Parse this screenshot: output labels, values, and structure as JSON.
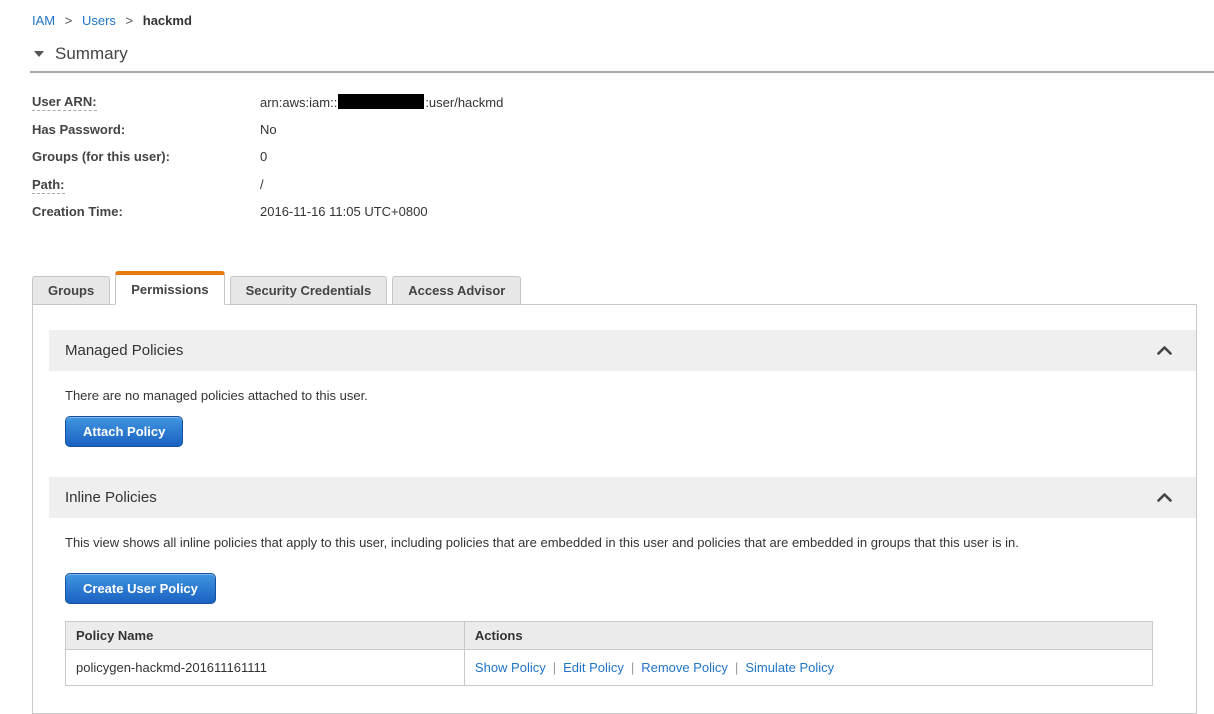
{
  "breadcrumb": {
    "separator": ">",
    "items": [
      {
        "label": "IAM"
      },
      {
        "label": "Users"
      },
      {
        "label": "hackmd"
      }
    ]
  },
  "summary": {
    "title": "Summary",
    "fields": [
      {
        "label": "User ARN:",
        "value_prefix": "arn:aws:iam::",
        "value_redacted": "account-id-redacted",
        "value_suffix": ":user/hackmd"
      },
      {
        "label": "Has Password:",
        "value": "No"
      },
      {
        "label": "Groups (for this user):",
        "value": "0"
      },
      {
        "label": "Path:",
        "value": "/"
      },
      {
        "label": "Creation Time:",
        "value": "2016-11-16 11:05 UTC+0800"
      }
    ]
  },
  "tabs": {
    "items": [
      "Groups",
      "Permissions",
      "Security Credentials",
      "Access Advisor"
    ],
    "active": "Permissions"
  },
  "managed_policies": {
    "title": "Managed Policies",
    "empty_text": "There are no managed policies attached to this user.",
    "attach_button_label": "Attach Policy"
  },
  "inline_policies": {
    "title": "Inline Policies",
    "description": "This view shows all inline policies that apply to this user, including policies that are embedded in this user and policies that are embedded in groups that this user is in.",
    "create_button_label": "Create User Policy",
    "table": {
      "headers": [
        "Policy Name",
        "Actions"
      ],
      "actions_separator": "|",
      "rows": [
        {
          "policy_name": "policygen-hackmd-201611161111",
          "actions": [
            "Show Policy",
            "Edit Policy",
            "Remove Policy",
            "Simulate Policy"
          ]
        }
      ]
    }
  },
  "colors": {
    "link_blue": "#2075c7",
    "tab_accent_orange": "#e8790f",
    "button_blue_top": "#4095e0",
    "button_blue_bottom": "#1b62c3",
    "section_header_gray": "#efefef"
  }
}
